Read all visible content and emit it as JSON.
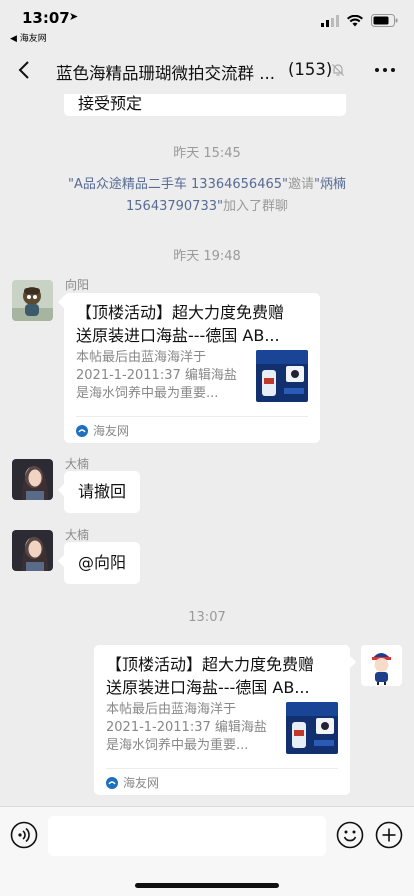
{
  "status_bar": {
    "time": "13:07",
    "location_arrow": "➤",
    "back_app": "◀ 海友网"
  },
  "nav": {
    "title": "蓝色海精品珊瑚微拍交流群 ...",
    "member_count": "(153)"
  },
  "chat": {
    "prev_message": "接受预定",
    "time_1": "昨天 15:45",
    "system": {
      "inviter": "\"A品众途精品二手车 13364656465\"",
      "invite_word": "邀请",
      "invitee": "\"炳楠 15643790733\"",
      "joined": "加入了群聊"
    },
    "time_2": "昨天 19:48",
    "msg1": {
      "sender": "向阳",
      "card": {
        "title_line1": "【顶楼活动】超大力度免费赠",
        "title_line2": "送原装进口海盐---德国 AB...",
        "desc_line1": "本帖最后由蓝海海洋于",
        "desc_line2": "2021-1-2011:37 编辑海盐",
        "desc_line3": "是海水饲养中最为重要...",
        "source": "海友网"
      }
    },
    "msg2": {
      "sender": "大楠",
      "text": "请撤回"
    },
    "msg3": {
      "sender": "大楠",
      "text": "@向阳"
    },
    "time_3": "13:07",
    "msg4": {
      "card": {
        "title_line1": "【顶楼活动】超大力度免费赠",
        "title_line2": "送原装进口海盐---德国 AB...",
        "desc_line1": "本帖最后由蓝海海洋于",
        "desc_line2": "2021-1-2011:37 编辑海盐",
        "desc_line3": "是海水饲养中最为重要...",
        "source": "海友网"
      }
    }
  },
  "input_bar": {
    "placeholder": ""
  },
  "colors": {
    "background": "#ededed",
    "bubble": "#ffffff",
    "link": "#576b95",
    "meta_text": "#9a9a9a"
  }
}
